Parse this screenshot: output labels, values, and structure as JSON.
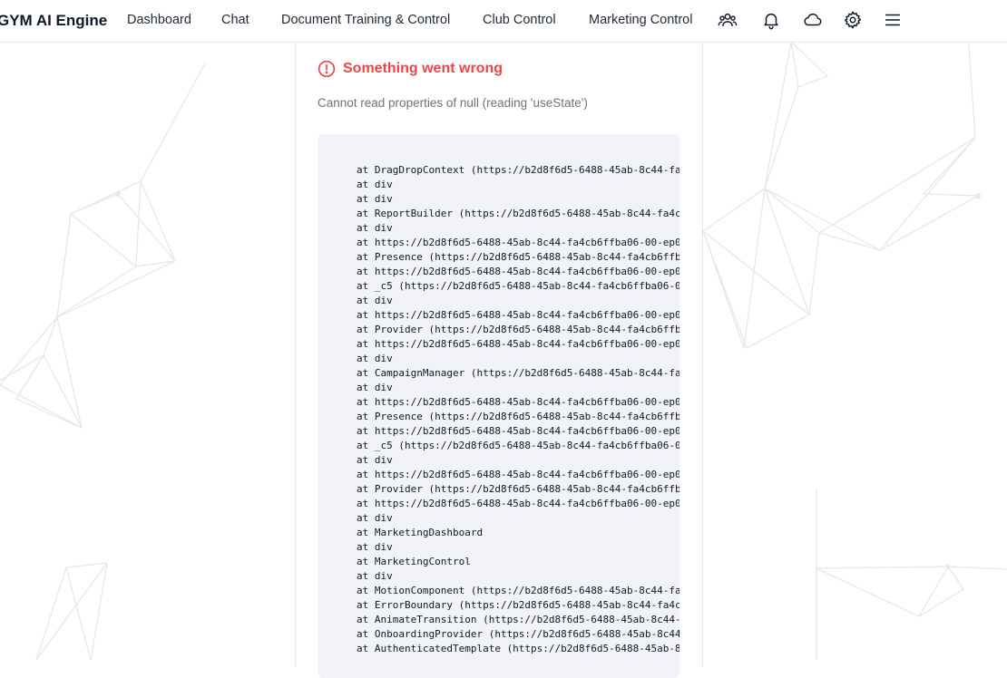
{
  "header": {
    "brand": "GYM AI Engine",
    "nav": [
      "Dashboard",
      "Chat",
      "Document Training & Control",
      "Club Control",
      "Marketing Control"
    ],
    "icons": [
      "users-icon",
      "bell-icon",
      "cloud-icon",
      "gear-icon",
      "menu-icon"
    ]
  },
  "error": {
    "title": "Something went wrong",
    "message": "Cannot read properties of null (reading 'useState')",
    "accent_color": "#ef4444",
    "stack": [
      "at DragDropContext (https://b2d8f6d5-6488-45ab-8c44-fa",
      "at div",
      "at div",
      "at ReportBuilder (https://b2d8f6d5-6488-45ab-8c44-fa4c",
      "at div",
      "at https://b2d8f6d5-6488-45ab-8c44-fa4cb6ffba06-00-ep0",
      "at Presence (https://b2d8f6d5-6488-45ab-8c44-fa4cb6ffb",
      "at https://b2d8f6d5-6488-45ab-8c44-fa4cb6ffba06-00-ep0",
      "at _c5 (https://b2d8f6d5-6488-45ab-8c44-fa4cb6ffba06-0",
      "at div",
      "at https://b2d8f6d5-6488-45ab-8c44-fa4cb6ffba06-00-ep0",
      "at Provider (https://b2d8f6d5-6488-45ab-8c44-fa4cb6ffb",
      "at https://b2d8f6d5-6488-45ab-8c44-fa4cb6ffba06-00-ep0",
      "at div",
      "at CampaignManager (https://b2d8f6d5-6488-45ab-8c44-fa",
      "at div",
      "at https://b2d8f6d5-6488-45ab-8c44-fa4cb6ffba06-00-ep0",
      "at Presence (https://b2d8f6d5-6488-45ab-8c44-fa4cb6ffb",
      "at https://b2d8f6d5-6488-45ab-8c44-fa4cb6ffba06-00-ep0",
      "at _c5 (https://b2d8f6d5-6488-45ab-8c44-fa4cb6ffba06-0",
      "at div",
      "at https://b2d8f6d5-6488-45ab-8c44-fa4cb6ffba06-00-ep0",
      "at Provider (https://b2d8f6d5-6488-45ab-8c44-fa4cb6ffb",
      "at https://b2d8f6d5-6488-45ab-8c44-fa4cb6ffba06-00-ep0",
      "at div",
      "at MarketingDashboard",
      "at div",
      "at MarketingControl",
      "at div",
      "at MotionComponent (https://b2d8f6d5-6488-45ab-8c44-fa",
      "at ErrorBoundary (https://b2d8f6d5-6488-45ab-8c44-fa4c",
      "at AnimateTransition (https://b2d8f6d5-6488-45ab-8c44-",
      "at OnboardingProvider (https://b2d8f6d5-6488-45ab-8c44",
      "at AuthenticatedTemplate (https://b2d8f6d5-6488-45ab-8"
    ]
  }
}
